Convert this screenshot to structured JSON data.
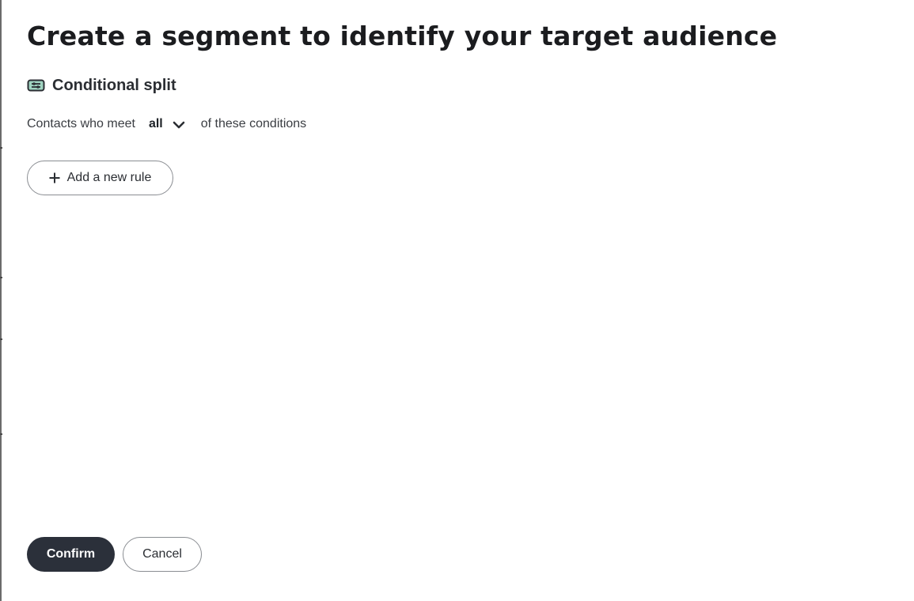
{
  "page": {
    "title": "Create a segment to identify your target audience"
  },
  "section": {
    "icon": "conditional-split-icon",
    "title": "Conditional split"
  },
  "conditions": {
    "prefix": "Contacts who meet",
    "match_value": "all",
    "match_icon": "chevron-down-icon",
    "suffix": "of these conditions"
  },
  "rules": {
    "add_icon": "plus-icon",
    "add_label": "Add a new rule"
  },
  "footer": {
    "confirm_label": "Confirm",
    "cancel_label": "Cancel"
  },
  "colors": {
    "primary_button": "#2b303a",
    "icon_accent": "#9fd3c0"
  }
}
